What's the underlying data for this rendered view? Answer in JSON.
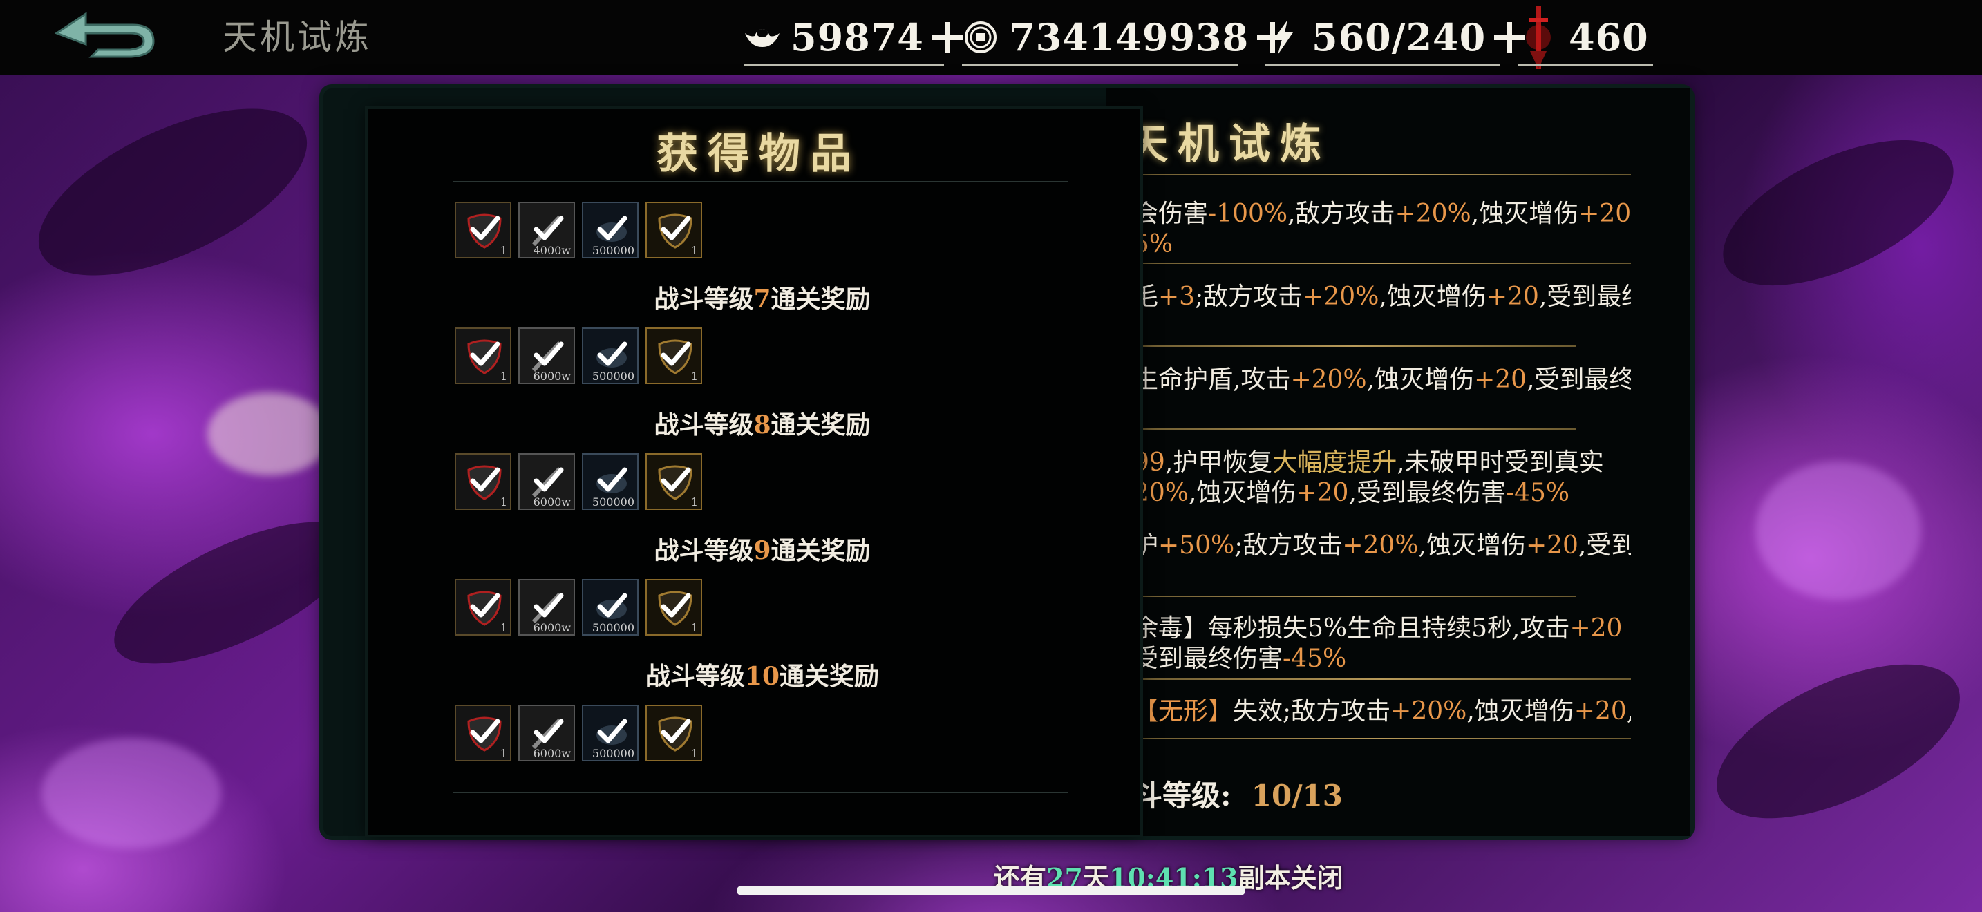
{
  "header": {
    "title": "天机试炼",
    "resources": [
      {
        "icon": "ingot-icon",
        "value": "59874"
      },
      {
        "icon": "coin-icon",
        "value": "734149938"
      },
      {
        "icon": "lightning-icon",
        "value": "560/240"
      },
      {
        "icon": "blood-sword-icon",
        "value": "460"
      }
    ]
  },
  "rewards": {
    "title": "获得物品",
    "sections": [
      {
        "label_pre": "",
        "label_num": "",
        "label_post": "",
        "items": [
          {
            "type": "mask",
            "qty": "1"
          },
          {
            "type": "weapon",
            "qty": "4000w"
          },
          {
            "type": "fish",
            "qty": "500000"
          },
          {
            "type": "gold-mask",
            "qty": "1"
          }
        ]
      },
      {
        "label_pre": "战斗等级",
        "label_num": "7",
        "label_post": "通关奖励",
        "items": [
          {
            "type": "mask",
            "qty": "1"
          },
          {
            "type": "weapon",
            "qty": "6000w"
          },
          {
            "type": "fish",
            "qty": "500000"
          },
          {
            "type": "gold-mask",
            "qty": "1"
          }
        ]
      },
      {
        "label_pre": "战斗等级",
        "label_num": "8",
        "label_post": "通关奖励",
        "items": [
          {
            "type": "mask",
            "qty": "1"
          },
          {
            "type": "weapon",
            "qty": "6000w"
          },
          {
            "type": "fish",
            "qty": "500000"
          },
          {
            "type": "gold-mask",
            "qty": "1"
          }
        ]
      },
      {
        "label_pre": "战斗等级",
        "label_num": "9",
        "label_post": "通关奖励",
        "items": [
          {
            "type": "mask",
            "qty": "1"
          },
          {
            "type": "weapon",
            "qty": "6000w"
          },
          {
            "type": "fish",
            "qty": "500000"
          },
          {
            "type": "gold-mask",
            "qty": "1"
          }
        ]
      },
      {
        "label_pre": "战斗等级",
        "label_num": "10",
        "label_post": "通关奖励",
        "items": [
          {
            "type": "mask",
            "qty": "1"
          },
          {
            "type": "weapon",
            "qty": "6000w"
          },
          {
            "type": "fish",
            "qty": "500000"
          },
          {
            "type": "gold-mask",
            "qty": "1"
          }
        ]
      }
    ]
  },
  "trial": {
    "title": "天机试炼",
    "rules": [
      {
        "l1": [
          "会伤害",
          "-100%",
          ",敌方攻击",
          "+20%",
          ",蚀灭增伤",
          "+20"
        ],
        "l2": [
          "5%"
        ]
      },
      {
        "l1": [
          "毛",
          "+3",
          ";敌方攻击",
          "+20%",
          ",蚀灭增伤",
          "+20",
          ",受到最终"
        ],
        "l2": []
      },
      {
        "l1": [
          "生命护盾,攻击",
          "+20%",
          ",蚀灭增伤",
          "+20",
          ",受到最终"
        ],
        "l2": []
      },
      {
        "l1": [
          "99",
          ",护甲恢复",
          "大幅度提升",
          ",未破甲时受到真实"
        ],
        "l2": [
          "20%",
          ",蚀灭增伤",
          "+20",
          ",受到最终伤害",
          "-45%"
        ]
      },
      {
        "l1": [
          "护",
          "+50%",
          ";敌方攻击",
          "+20%",
          ",蚀灭增伤",
          "+20",
          ",受到"
        ],
        "l2": []
      },
      {
        "l1": [
          "余毒】每秒损失5%生命且持续5秒,攻击",
          "+20"
        ],
        "l2": [
          "受到最终伤害",
          "-45%"
        ]
      },
      {
        "l1": [
          "【无形】",
          "失效;敌方攻击",
          "+20%",
          ",蚀灭增伤",
          "+20",
          ","
        ],
        "l2": []
      }
    ],
    "level_label": "斗等级:",
    "level_value": "10/13"
  },
  "footer": {
    "pre": "还有",
    "days": "27",
    "mid": "天",
    "time": "10:41:13",
    "post": "副本关闭"
  }
}
